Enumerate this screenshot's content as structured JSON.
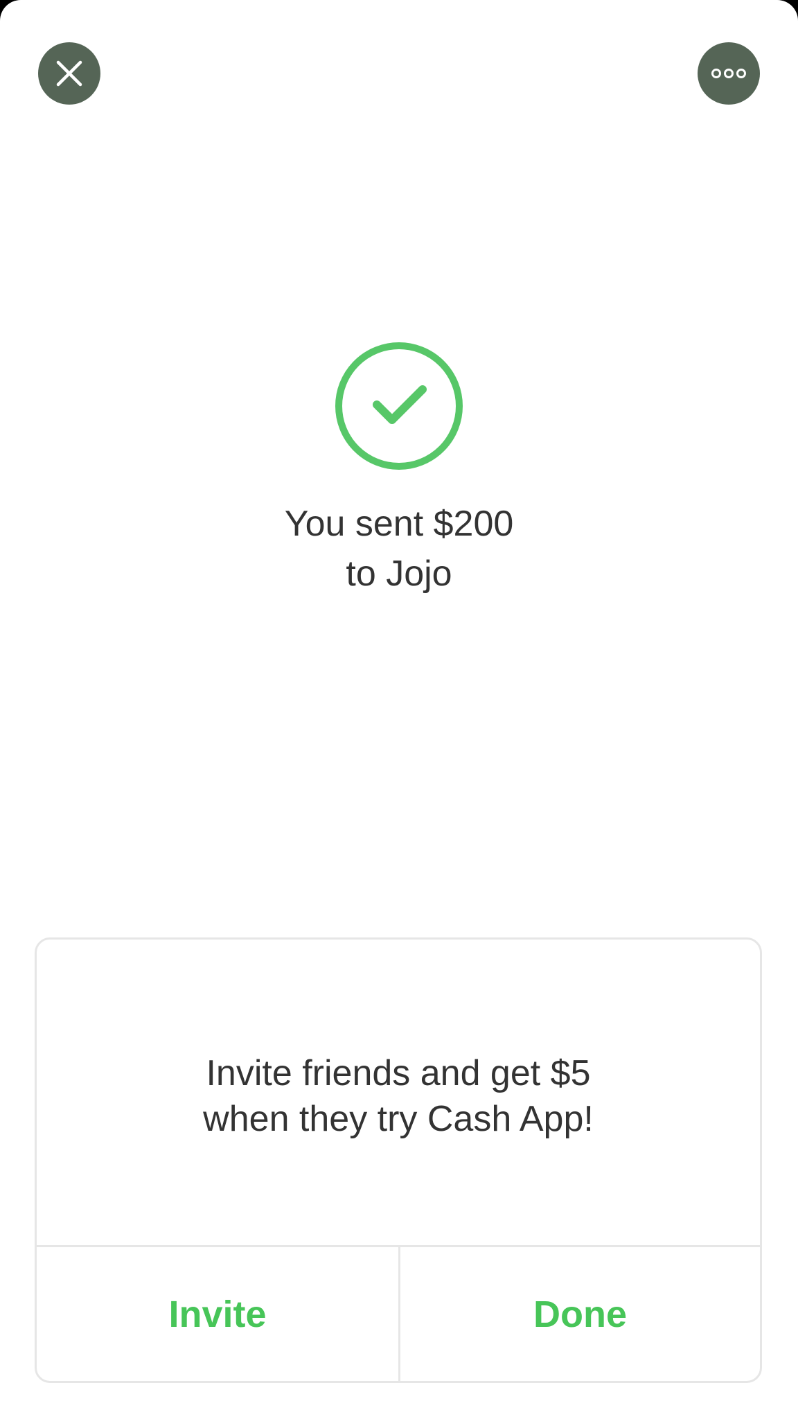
{
  "header": {
    "close_icon": "close-icon",
    "more_icon": "more-options-icon"
  },
  "status": {
    "icon": "check-circle-icon",
    "message_line1": "You sent $200",
    "message_line2": "to Jojo"
  },
  "promo": {
    "text_line1": "Invite friends and get $5",
    "text_line2": "when they try Cash App!",
    "invite_label": "Invite",
    "done_label": "Done"
  },
  "colors": {
    "accent_green": "#47c558",
    "header_button_bg": "#556556",
    "text": "#333333",
    "divider": "#e6e6e6"
  }
}
